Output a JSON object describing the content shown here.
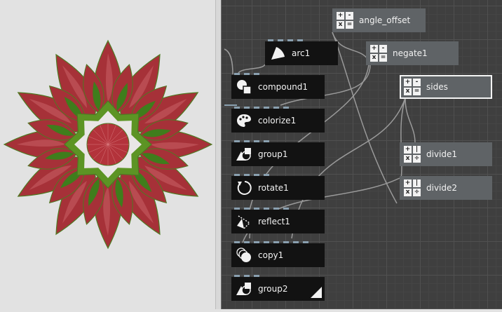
{
  "viewer": {
    "flower": {
      "petal_color": "#a63138",
      "petal_stroke": "#4e7a22",
      "leaf_color": "#3f7d1c",
      "highlight_color": "#c2575c",
      "center_color": "#b3333b",
      "star_color": "#5c9424"
    }
  },
  "network": {
    "nodes": [
      {
        "id": "angle_offset",
        "label": "angle_offset",
        "icon": "math-icon",
        "style": "grey"
      },
      {
        "id": "arc1",
        "label": "arc1",
        "icon": "arc-icon",
        "style": "dark"
      },
      {
        "id": "negate1",
        "label": "negate1",
        "icon": "math-icon",
        "style": "grey"
      },
      {
        "id": "compound1",
        "label": "compound1",
        "icon": "compound-icon",
        "style": "dark"
      },
      {
        "id": "sides",
        "label": "sides",
        "icon": "math-icon",
        "style": "grey"
      },
      {
        "id": "colorize1",
        "label": "colorize1",
        "icon": "colorize-icon",
        "style": "dark"
      },
      {
        "id": "group1",
        "label": "group1",
        "icon": "group-icon",
        "style": "dark"
      },
      {
        "id": "divide1",
        "label": "divide1",
        "icon": "divide-icon",
        "style": "grey"
      },
      {
        "id": "rotate1",
        "label": "rotate1",
        "icon": "rotate-icon",
        "style": "dark"
      },
      {
        "id": "divide2",
        "label": "divide2",
        "icon": "divide-icon",
        "style": "grey"
      },
      {
        "id": "reflect1",
        "label": "reflect1",
        "icon": "reflect-icon",
        "style": "dark"
      },
      {
        "id": "copy1",
        "label": "copy1",
        "icon": "copy-icon",
        "style": "dark"
      },
      {
        "id": "group2",
        "label": "group2",
        "icon": "group-icon",
        "style": "dark",
        "rendered": true
      }
    ],
    "math_symbols": [
      "+",
      "-",
      "x",
      "="
    ],
    "divide_symbols": [
      "+",
      "|",
      "x",
      "÷"
    ]
  }
}
